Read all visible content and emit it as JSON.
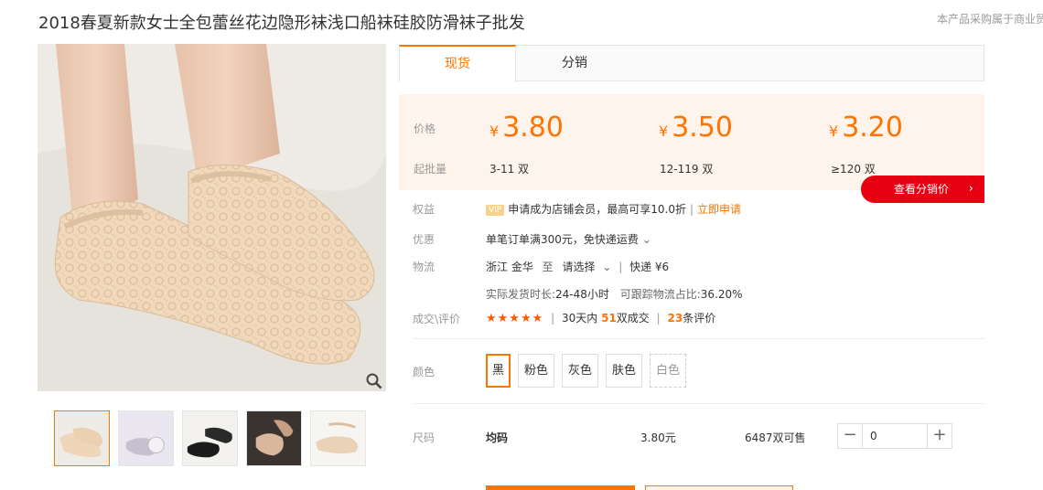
{
  "product": {
    "title": "2018春夏新款女士全包蕾丝花边隐形袜浅口船袜硅胶防滑袜子批发",
    "notice": "本产品采购属于商业贸"
  },
  "tabs": [
    {
      "label": "现货"
    },
    {
      "label": "分销"
    }
  ],
  "price_box": {
    "price_label": "价格",
    "qty_label": "起批量",
    "currency": "¥",
    "tiers": [
      {
        "price": "3.80",
        "qty": "3-11 双"
      },
      {
        "price": "3.50",
        "qty": "12-119 双"
      },
      {
        "price": "3.20",
        "qty": "≥120 双"
      }
    ],
    "dist_button": "查看分销价"
  },
  "rights": {
    "label": "权益",
    "vip": "VIP",
    "text": "申请成为店铺会员，最高可享10.0折",
    "link": "立即申请"
  },
  "discount": {
    "label": "优惠",
    "text": "单笔订单满300元，免快递运费"
  },
  "logistics": {
    "label": "物流",
    "origin": "浙江 金华",
    "to": "至",
    "dest_select": "请选择",
    "express": "快递 ¥6",
    "ship_time_label": "实际发货时长:",
    "ship_time": "24-48小时",
    "track_label": "可跟踪物流占比:",
    "track_ratio": "36.20%"
  },
  "reviews": {
    "label": "成交\\评价",
    "stars": "★★★★★",
    "days_prefix": "30天内",
    "deals": "51",
    "deals_suffix": "双成交",
    "reviews_count": "23",
    "reviews_suffix": "条评价",
    "rating": 5
  },
  "color": {
    "label": "颜色",
    "options": [
      "黑",
      "粉色",
      "灰色",
      "肤色",
      "白色"
    ],
    "selected": "黑"
  },
  "size": {
    "label": "尺码",
    "value": "均码",
    "price": "3.80元",
    "stock": "6487双可售",
    "quantity": "0",
    "minus": "−",
    "plus": "+"
  },
  "colors": {
    "accent": "#ff7300",
    "dist_button": "#e60012",
    "price_bg": "#fff4eb"
  }
}
